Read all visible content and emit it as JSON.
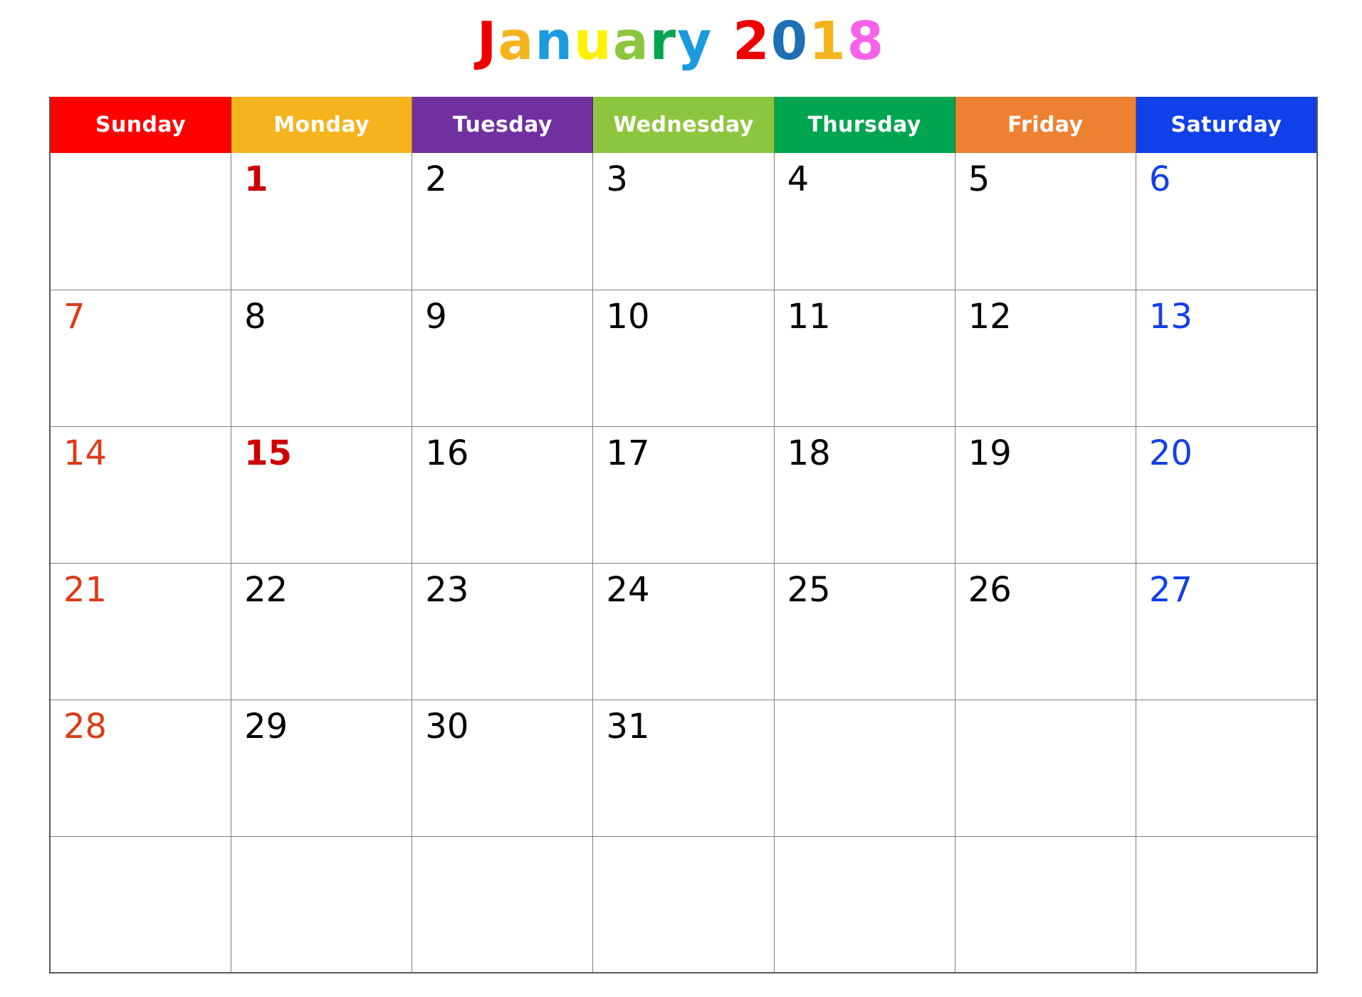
{
  "title": {
    "text": "January 2018",
    "letters": [
      {
        "ch": "J",
        "color": "#ee0000"
      },
      {
        "ch": "a",
        "color": "#f5b41d"
      },
      {
        "ch": "n",
        "color": "#1b9ae0"
      },
      {
        "ch": "u",
        "color": "#fff200"
      },
      {
        "ch": "a",
        "color": "#8cc63e"
      },
      {
        "ch": "r",
        "color": "#00a550"
      },
      {
        "ch": "y",
        "color": "#1b9ae0"
      },
      {
        "ch": " ",
        "color": "#ffffff"
      },
      {
        "ch": "2",
        "color": "#ee0000"
      },
      {
        "ch": "0",
        "color": "#1f6fb4"
      },
      {
        "ch": "1",
        "color": "#f5b41d"
      },
      {
        "ch": "8",
        "color": "#f763e8"
      }
    ]
  },
  "weekdays": [
    {
      "label": "Sunday",
      "bg": "#ff0000"
    },
    {
      "label": "Monday",
      "bg": "#f5b41d"
    },
    {
      "label": "Tuesday",
      "bg": "#7030a0"
    },
    {
      "label": "Wednesday",
      "bg": "#8cc63e"
    },
    {
      "label": "Thursday",
      "bg": "#00a550"
    },
    {
      "label": "Friday",
      "bg": "#ed8031"
    },
    {
      "label": "Saturday",
      "bg": "#1040e8"
    }
  ],
  "weeks": [
    [
      {
        "day": ""
      },
      {
        "day": "1",
        "style": "holiday"
      },
      {
        "day": "2"
      },
      {
        "day": "3"
      },
      {
        "day": "4"
      },
      {
        "day": "5"
      },
      {
        "day": "6",
        "style": "saturday"
      }
    ],
    [
      {
        "day": "7",
        "style": "sunday"
      },
      {
        "day": "8"
      },
      {
        "day": "9"
      },
      {
        "day": "10"
      },
      {
        "day": "11"
      },
      {
        "day": "12"
      },
      {
        "day": "13",
        "style": "saturday"
      }
    ],
    [
      {
        "day": "14",
        "style": "sunday"
      },
      {
        "day": "15",
        "style": "holiday"
      },
      {
        "day": "16"
      },
      {
        "day": "17"
      },
      {
        "day": "18"
      },
      {
        "day": "19"
      },
      {
        "day": "20",
        "style": "saturday"
      }
    ],
    [
      {
        "day": "21",
        "style": "sunday"
      },
      {
        "day": "22"
      },
      {
        "day": "23"
      },
      {
        "day": "24"
      },
      {
        "day": "25"
      },
      {
        "day": "26"
      },
      {
        "day": "27",
        "style": "saturday"
      }
    ],
    [
      {
        "day": "28",
        "style": "sunday"
      },
      {
        "day": "29"
      },
      {
        "day": "30"
      },
      {
        "day": "31"
      },
      {
        "day": ""
      },
      {
        "day": ""
      },
      {
        "day": ""
      }
    ],
    [
      {
        "day": ""
      },
      {
        "day": ""
      },
      {
        "day": ""
      },
      {
        "day": ""
      },
      {
        "day": ""
      },
      {
        "day": ""
      },
      {
        "day": ""
      }
    ]
  ],
  "colors": {
    "sunday_date": "#dc3c17",
    "saturday_date": "#1040e8",
    "holiday_date": "#cc0000",
    "weekday_date": "#000000",
    "grid_line": "#7f7f7f",
    "grid_border": "#595959",
    "page_background": "#ffffff"
  }
}
